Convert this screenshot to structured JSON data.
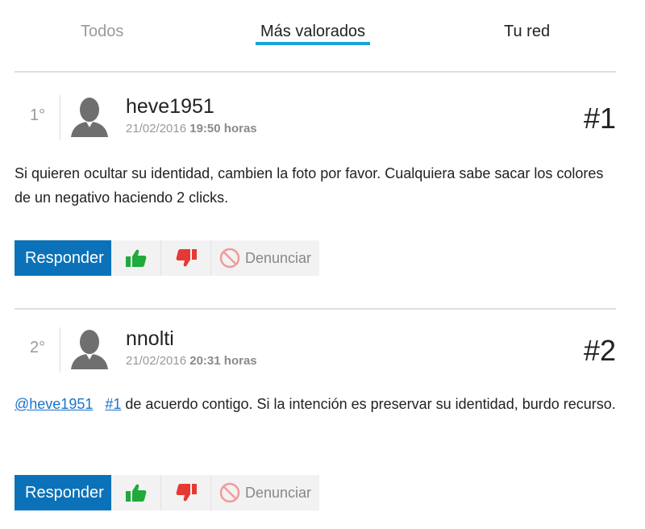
{
  "tabs": [
    {
      "label": "Todos"
    },
    {
      "label": "Más valorados"
    },
    {
      "label": "Tu red"
    }
  ],
  "comments": [
    {
      "rank": "1°",
      "username": "heve1951",
      "date": "21/02/2016",
      "time": "19:50 horas",
      "number": "#1",
      "text": "Si quieren ocultar su identidad, cambien la foto por favor. Cualquiera sabe sacar los colores de un negativo haciendo 2 clicks."
    },
    {
      "rank": "2°",
      "username": "nnolti",
      "date": "21/02/2016",
      "time": "20:31 horas",
      "number": "#2",
      "mention": "@heve1951",
      "ref": "#1",
      "text": " de acuerdo contigo. Si la intención es preservar su identidad, burdo recurso."
    }
  ],
  "actions": {
    "reply_label": "Responder",
    "report_label": "Denunciar"
  },
  "colors": {
    "accent": "#1aa3d6",
    "reply_bg": "#0b72b9",
    "like": "#1faa3b",
    "dislike": "#e53935",
    "report": "#f19a9a"
  },
  "icons": [
    "avatar-icon",
    "thumbs-up-icon",
    "thumbs-down-icon",
    "prohibited-icon"
  ]
}
